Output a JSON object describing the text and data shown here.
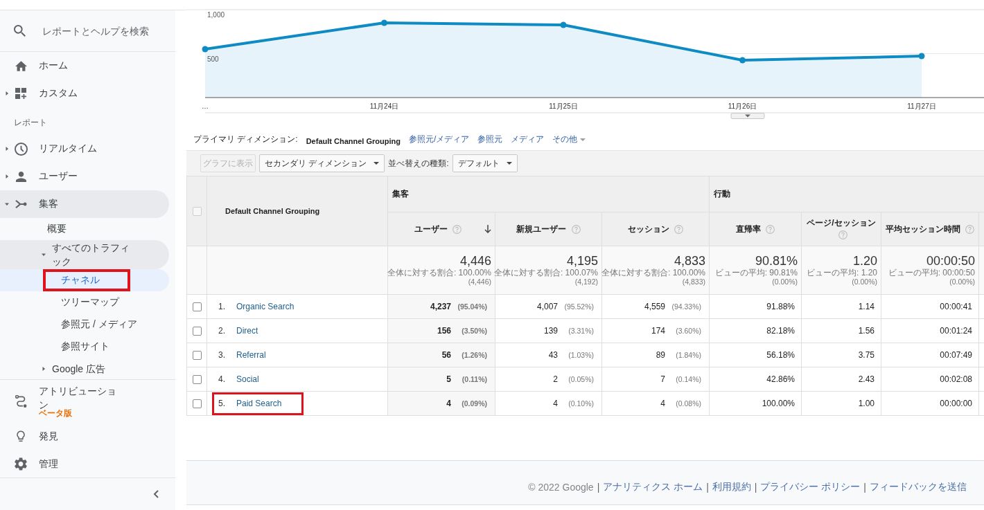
{
  "sidebar": {
    "search": {
      "placeholder": "レポートとヘルプを検索"
    },
    "nav": [
      {
        "kind": "page",
        "label": "ホーム"
      },
      {
        "kind": "group",
        "label": "カスタム",
        "expanded": false
      }
    ],
    "section_heading": "レポート",
    "reports": [
      {
        "label": "リアルタイム",
        "expanded": false
      },
      {
        "label": "ユーザー",
        "expanded": false
      },
      {
        "label": "集客",
        "expanded": true,
        "children": [
          {
            "kind": "page",
            "label": "概要",
            "selected": false
          },
          {
            "kind": "group",
            "label": "すべてのトラフィック",
            "expanded": true,
            "children": [
              {
                "label": "チャネル",
                "selected": true,
                "highlighted": true
              },
              {
                "label": "ツリーマップ",
                "selected": false,
                "highlighted": false
              },
              {
                "label": "参照元 / メディア",
                "selected": false,
                "highlighted": false
              },
              {
                "label": "参照サイト",
                "selected": false,
                "highlighted": false
              }
            ]
          },
          {
            "kind": "group",
            "label": "Google 広告",
            "expanded": false
          }
        ]
      }
    ],
    "tools": [
      {
        "label": "アトリビューション",
        "badge": "ベータ版"
      },
      {
        "label": "発見"
      },
      {
        "label": "管理"
      }
    ]
  },
  "chart": {
    "chart_data": {
      "type": "area",
      "categories": [
        "…",
        "11月24日",
        "11月25日",
        "11月26日",
        "11月27日"
      ],
      "values": [
        551,
        850,
        827,
        425,
        472
      ],
      "ylim": [
        0,
        1000
      ],
      "yticks": [
        {
          "value": 500,
          "label": "500"
        },
        {
          "value": 1000,
          "label": "1,000"
        }
      ]
    }
  },
  "dimension_bar": {
    "label": "プライマリ ディメンション:",
    "options": [
      {
        "kind": "link",
        "label": "Default Channel Grouping",
        "selected": true
      },
      {
        "kind": "link",
        "label": "参照元/メディア",
        "selected": false
      },
      {
        "kind": "link",
        "label": "参照元",
        "selected": false
      },
      {
        "kind": "link",
        "label": "メディア",
        "selected": false
      },
      {
        "kind": "menu",
        "label": "その他",
        "selected": false
      }
    ]
  },
  "toolbar": {
    "chart_button": {
      "label": "グラフに表示",
      "disabled": true
    },
    "secondary_dimension": {
      "label": "セカンダリ ディメンション"
    },
    "sort_label": "並べ替えの種類:",
    "sort_type": {
      "value": "デフォルト"
    }
  },
  "table": {
    "select_all": {
      "checked": false
    },
    "dimension_heading": "Default Channel Grouping",
    "groups": [
      {
        "label": "集客",
        "columns": [
          {
            "label": "ユーザー",
            "sorted": true
          },
          {
            "label": "新規ユーザー",
            "sorted": false
          },
          {
            "label": "セッション",
            "sorted": false
          }
        ]
      },
      {
        "label": "行動",
        "columns": [
          {
            "label": "直帰率",
            "sorted": false
          },
          {
            "label": "ページ/セッション",
            "sorted": false
          },
          {
            "label": "平均セッション時間",
            "sorted": false
          }
        ]
      }
    ],
    "totals": [
      {
        "value": "4,446",
        "note": "全体に対する割合: 100.00%",
        "base": "(4,446)"
      },
      {
        "value": "4,195",
        "note": "全体に対する割合: 100.07%",
        "base": "(4,192)"
      },
      {
        "value": "4,833",
        "note": "全体に対する割合: 100.00%",
        "base": "(4,833)"
      },
      {
        "value": "90.81%",
        "note": "ビューの平均: 90.81%",
        "base": "(0.00%)"
      },
      {
        "value": "1.20",
        "note": "ビューの平均: 1.20",
        "base": "(0.00%)"
      },
      {
        "value": "00:00:50",
        "note": "ビューの平均: 00:00:50",
        "base": "(0.00%)"
      }
    ],
    "rows": [
      {
        "checked": false,
        "rank": "1.",
        "name": "Organic Search",
        "highlighted": false,
        "cells": [
          {
            "value": "4,237",
            "share": "(95.04%)"
          },
          {
            "value": "4,007",
            "share": "(95.52%)"
          },
          {
            "value": "4,559",
            "share": "(94.33%)"
          },
          {
            "value": "91.88%"
          },
          {
            "value": "1.14"
          },
          {
            "value": "00:00:41"
          }
        ]
      },
      {
        "checked": false,
        "rank": "2.",
        "name": "Direct",
        "highlighted": false,
        "cells": [
          {
            "value": "156",
            "share": "(3.50%)"
          },
          {
            "value": "139",
            "share": "(3.31%)"
          },
          {
            "value": "174",
            "share": "(3.60%)"
          },
          {
            "value": "82.18%"
          },
          {
            "value": "1.56"
          },
          {
            "value": "00:01:24"
          }
        ]
      },
      {
        "checked": false,
        "rank": "3.",
        "name": "Referral",
        "highlighted": false,
        "cells": [
          {
            "value": "56",
            "share": "(1.26%)"
          },
          {
            "value": "43",
            "share": "(1.03%)"
          },
          {
            "value": "89",
            "share": "(1.84%)"
          },
          {
            "value": "56.18%"
          },
          {
            "value": "3.75"
          },
          {
            "value": "00:07:49"
          }
        ]
      },
      {
        "checked": false,
        "rank": "4.",
        "name": "Social",
        "highlighted": false,
        "cells": [
          {
            "value": "5",
            "share": "(0.11%)"
          },
          {
            "value": "2",
            "share": "(0.05%)"
          },
          {
            "value": "7",
            "share": "(0.14%)"
          },
          {
            "value": "42.86%"
          },
          {
            "value": "2.43"
          },
          {
            "value": "00:02:08"
          }
        ]
      },
      {
        "checked": false,
        "rank": "5.",
        "name": "Paid Search",
        "highlighted": true,
        "cells": [
          {
            "value": "4",
            "share": "(0.09%)"
          },
          {
            "value": "4",
            "share": "(0.10%)"
          },
          {
            "value": "4",
            "share": "(0.08%)"
          },
          {
            "value": "100.00%"
          },
          {
            "value": "1.00"
          },
          {
            "value": "00:00:00"
          }
        ]
      }
    ]
  },
  "footer": {
    "copyright": "© 2022 Google",
    "separator": "|",
    "links": [
      "アナリティクス ホーム",
      "利用規約",
      "プライバシー ポリシー",
      "フィードバックを送信"
    ]
  }
}
